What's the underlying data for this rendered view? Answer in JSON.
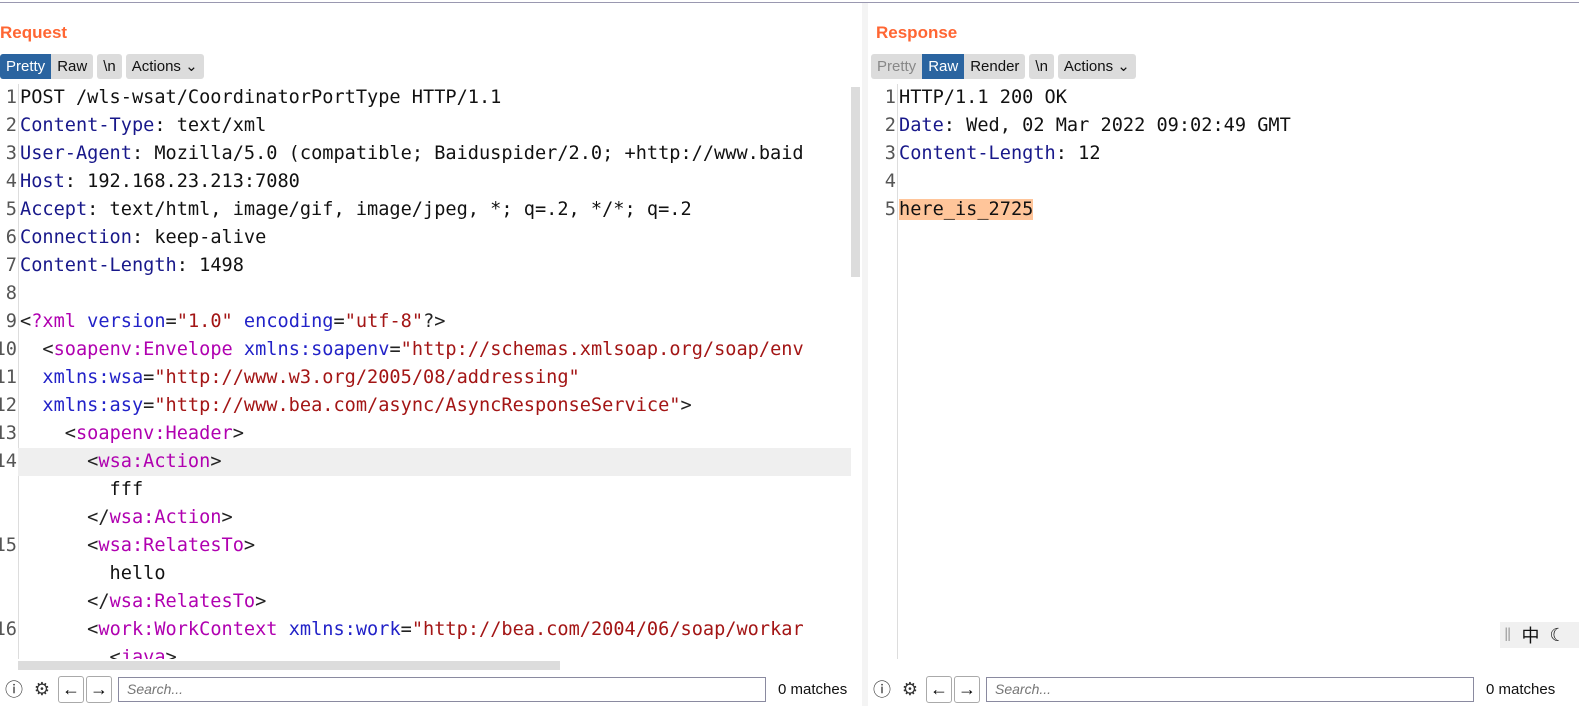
{
  "request": {
    "title": "Request",
    "tabs": [
      "Pretty",
      "Raw"
    ],
    "active_tab": "Pretty",
    "newline_label": "\\n",
    "actions_label": "Actions",
    "lines": [
      {
        "n": "1",
        "tokens": [
          {
            "t": "POST /wls-wsat/CoordinatorPortType HTTP/1.1",
            "c": "hv"
          }
        ]
      },
      {
        "n": "2",
        "tokens": [
          {
            "t": "Content-Type",
            "c": "hn"
          },
          {
            "t": ": text/xml",
            "c": "hv"
          }
        ]
      },
      {
        "n": "3",
        "tokens": [
          {
            "t": "User-Agent",
            "c": "hn"
          },
          {
            "t": ": Mozilla/5.0 (compatible; Baiduspider/2.0; +http://www.baid",
            "c": "hv"
          }
        ]
      },
      {
        "n": "4",
        "tokens": [
          {
            "t": "Host",
            "c": "hn"
          },
          {
            "t": ": 192.168.23.213:7080",
            "c": "hv"
          }
        ]
      },
      {
        "n": "5",
        "tokens": [
          {
            "t": "Accept",
            "c": "hn"
          },
          {
            "t": ": text/html, image/gif, image/jpeg, *; q=.2, */*; q=.2",
            "c": "hv"
          }
        ]
      },
      {
        "n": "6",
        "tokens": [
          {
            "t": "Connection",
            "c": "hn"
          },
          {
            "t": ": keep-alive",
            "c": "hv"
          }
        ]
      },
      {
        "n": "7",
        "tokens": [
          {
            "t": "Content-Length",
            "c": "hn"
          },
          {
            "t": ": 1498",
            "c": "hv"
          }
        ]
      },
      {
        "n": "8",
        "tokens": []
      },
      {
        "n": "9",
        "tokens": [
          {
            "t": "<",
            "c": "p"
          },
          {
            "t": "?xml",
            "c": "tag"
          },
          {
            "t": " version",
            "c": "attr"
          },
          {
            "t": "=",
            "c": "p"
          },
          {
            "t": "\"1.0\"",
            "c": "str"
          },
          {
            "t": " encoding",
            "c": "attr"
          },
          {
            "t": "=",
            "c": "p"
          },
          {
            "t": "\"utf-8\"",
            "c": "str"
          },
          {
            "t": "?>",
            "c": "p"
          }
        ]
      },
      {
        "n": "10",
        "tokens": [
          {
            "t": "  <",
            "c": "p"
          },
          {
            "t": "soapenv:Envelope",
            "c": "tag"
          },
          {
            "t": " xmlns:soapenv",
            "c": "attr"
          },
          {
            "t": "=",
            "c": "p"
          },
          {
            "t": "\"http://schemas.xmlsoap.org/soap/env",
            "c": "str"
          }
        ]
      },
      {
        "n": "11",
        "tokens": [
          {
            "t": "  xmlns:wsa",
            "c": "attr"
          },
          {
            "t": "=",
            "c": "p"
          },
          {
            "t": "\"http://www.w3.org/2005/08/addressing\"",
            "c": "str"
          }
        ]
      },
      {
        "n": "12",
        "tokens": [
          {
            "t": "  xmlns:asy",
            "c": "attr"
          },
          {
            "t": "=",
            "c": "p"
          },
          {
            "t": "\"http://www.bea.com/async/AsyncResponseService\"",
            "c": "str"
          },
          {
            "t": ">",
            "c": "p"
          }
        ]
      },
      {
        "n": "13",
        "tokens": [
          {
            "t": "    <",
            "c": "p"
          },
          {
            "t": "soapenv:Header",
            "c": "tag"
          },
          {
            "t": ">",
            "c": "p"
          }
        ]
      },
      {
        "n": "14",
        "hl": true,
        "tokens": [
          {
            "t": "      <",
            "c": "p"
          },
          {
            "t": "wsa:Action",
            "c": "tag"
          },
          {
            "t": ">",
            "c": "p"
          }
        ]
      },
      {
        "n": "",
        "tokens": [
          {
            "t": "        fff",
            "c": "txt"
          }
        ]
      },
      {
        "n": "",
        "tokens": [
          {
            "t": "      </",
            "c": "p"
          },
          {
            "t": "wsa:Action",
            "c": "tag"
          },
          {
            "t": ">",
            "c": "p"
          }
        ]
      },
      {
        "n": "15",
        "tokens": [
          {
            "t": "      <",
            "c": "p"
          },
          {
            "t": "wsa:RelatesTo",
            "c": "tag"
          },
          {
            "t": ">",
            "c": "p"
          }
        ]
      },
      {
        "n": "",
        "tokens": [
          {
            "t": "        hello",
            "c": "txt"
          }
        ]
      },
      {
        "n": "",
        "tokens": [
          {
            "t": "      </",
            "c": "p"
          },
          {
            "t": "wsa:RelatesTo",
            "c": "tag"
          },
          {
            "t": ">",
            "c": "p"
          }
        ]
      },
      {
        "n": "16",
        "tokens": [
          {
            "t": "      <",
            "c": "p"
          },
          {
            "t": "work:WorkContext",
            "c": "tag"
          },
          {
            "t": " xmlns:work",
            "c": "attr"
          },
          {
            "t": "=",
            "c": "p"
          },
          {
            "t": "\"http://bea.com/2004/06/soap/workar",
            "c": "str"
          }
        ]
      },
      {
        "n": "",
        "tokens": [
          {
            "t": "        <",
            "c": "p"
          },
          {
            "t": "java",
            "c": "tag"
          },
          {
            "t": ">",
            "c": "p"
          }
        ]
      }
    ],
    "search_placeholder": "Search...",
    "matches": "0 matches"
  },
  "response": {
    "title": "Response",
    "tabs": [
      "Pretty",
      "Raw",
      "Render"
    ],
    "active_tab": "Raw",
    "newline_label": "\\n",
    "actions_label": "Actions",
    "lines": [
      {
        "n": "1",
        "tokens": [
          {
            "t": "HTTP/1.1 200 OK",
            "c": "hv"
          }
        ]
      },
      {
        "n": "2",
        "tokens": [
          {
            "t": "Date",
            "c": "hn"
          },
          {
            "t": ": Wed, 02 Mar 2022 09:02:49 GMT",
            "c": "hv"
          }
        ]
      },
      {
        "n": "3",
        "tokens": [
          {
            "t": "Content-Length",
            "c": "hn"
          },
          {
            "t": ": 12",
            "c": "hv"
          }
        ]
      },
      {
        "n": "4",
        "tokens": []
      },
      {
        "n": "5",
        "tokens": [
          {
            "t": "here_is_2725",
            "c": "txt",
            "mark": true
          }
        ]
      }
    ],
    "search_placeholder": "Search...",
    "matches": "0 matches"
  },
  "ime": {
    "lang": "中"
  },
  "colors": {
    "accent": "#ff6633",
    "active_tab": "#2a64a0",
    "highlight": "#ffc59a",
    "tag": "#b000b0",
    "attr": "#2222c8",
    "string": "#a31515",
    "header_name": "#18188a"
  }
}
